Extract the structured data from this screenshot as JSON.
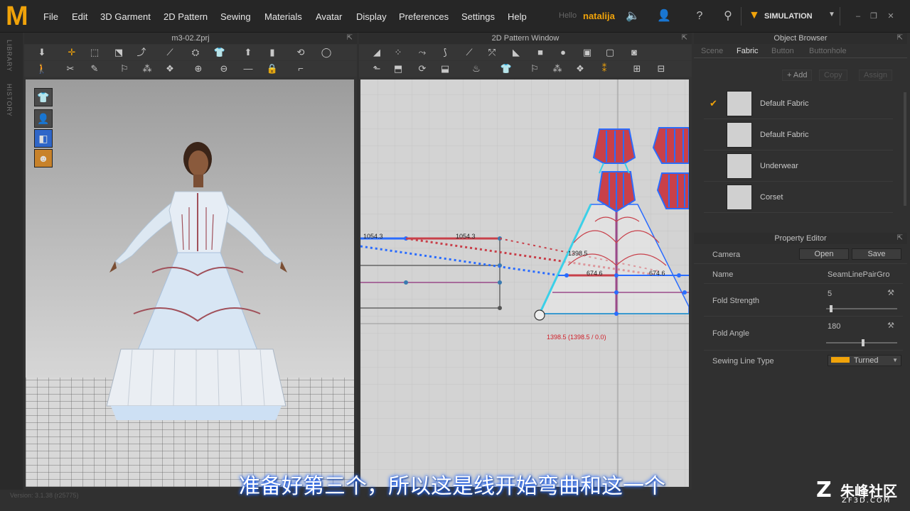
{
  "app": {
    "logo": "M"
  },
  "menubar": {
    "items": [
      "File",
      "Edit",
      "3D Garment",
      "2D Pattern",
      "Sewing",
      "Materials",
      "Avatar",
      "Display",
      "Preferences",
      "Settings",
      "Help"
    ],
    "hello": "Hello",
    "user": "natalija",
    "simulation_label": "SIMULATION"
  },
  "leftstrip": {
    "library": "LIBRARY",
    "history": "HISTORY"
  },
  "panel3d": {
    "title": "m3-02.Zprj"
  },
  "panel2d": {
    "title": "2D Pattern Window",
    "labels": {
      "l1": "1054.3",
      "l2": "1054.3",
      "l3": "1398.5",
      "l4": "674.6",
      "l5": "674.6"
    },
    "measure": "1398.5 (1398.5 / 0.0)"
  },
  "object_browser": {
    "title": "Object Browser",
    "tabs": [
      "Scene",
      "Fabric",
      "Button",
      "Buttonhole"
    ],
    "active_tab": "Fabric",
    "actions": [
      "+ Add",
      "Copy",
      "Assign"
    ],
    "fabrics": [
      {
        "name": "Default Fabric",
        "checked": true
      },
      {
        "name": "Default Fabric",
        "checked": false
      },
      {
        "name": "Underwear",
        "checked": false
      },
      {
        "name": "Corset",
        "checked": false
      }
    ]
  },
  "property_editor": {
    "title": "Property Editor",
    "camera_label": "Camera",
    "open_label": "Open",
    "save_label": "Save",
    "name_label": "Name",
    "name_value": "SeamLinePairGro",
    "fold_strength_label": "Fold Strength",
    "fold_strength_value": "5",
    "fold_strength_fraction": 0.05,
    "fold_angle_label": "Fold Angle",
    "fold_angle_value": "180",
    "fold_angle_fraction": 0.5,
    "sewing_line_type_label": "Sewing Line Type",
    "sewing_line_type_value": "Turned"
  },
  "status": {
    "version": "Version: 3.1.38 (r25775)"
  },
  "subtitle": "准备好第三个，所以这是线开始弯曲和这一个",
  "watermark": {
    "main": "朱峰社区",
    "sub": "ZF3D.COM",
    "z": "Z"
  },
  "colors": {
    "accent": "#f0a30a",
    "seam_blue": "#2a6cff",
    "seam_red": "#c8404a",
    "seam_cyan": "#3bd0e8"
  }
}
